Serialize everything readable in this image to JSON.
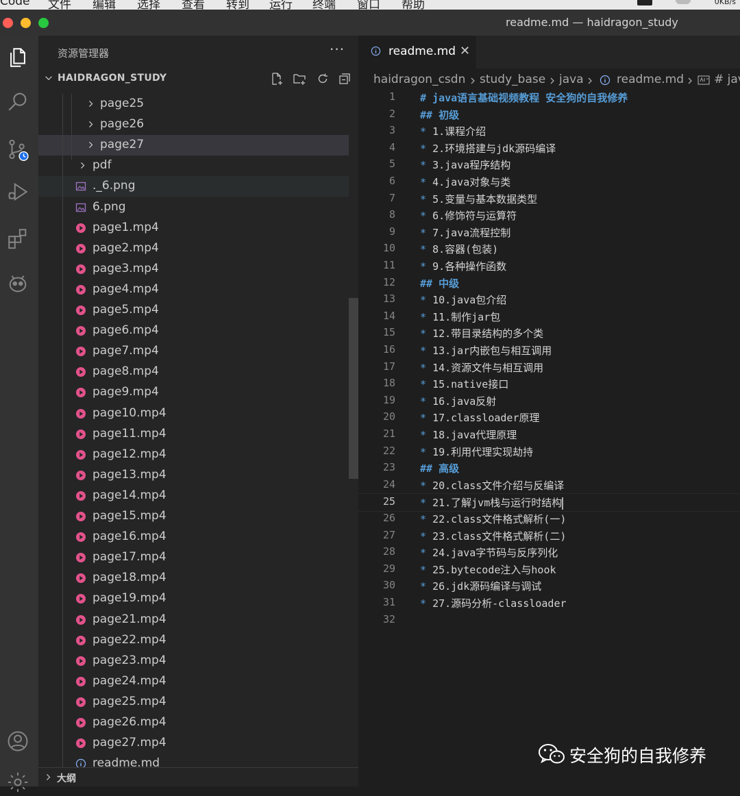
{
  "window": {
    "title": "readme.md — haidragon_study"
  },
  "menubar": {
    "items": [
      "Code",
      "文件",
      "编辑",
      "选择",
      "查看",
      "转到",
      "运行",
      "终端",
      "窗口",
      "帮助"
    ],
    "net_speed": "0KB/s"
  },
  "sidebar": {
    "title": "资源管理器",
    "more": "···",
    "folder": "HAIDRAGON_STUDY",
    "tree": [
      {
        "label": "page25",
        "type": "folder"
      },
      {
        "label": "page26",
        "type": "folder"
      },
      {
        "label": "page27",
        "type": "folder"
      },
      {
        "label": "pdf",
        "type": "folder"
      },
      {
        "label": "._6.png",
        "type": "image"
      },
      {
        "label": "6.png",
        "type": "image"
      },
      {
        "label": "page1.mp4",
        "type": "video"
      },
      {
        "label": "page2.mp4",
        "type": "video"
      },
      {
        "label": "page3.mp4",
        "type": "video"
      },
      {
        "label": "page4.mp4",
        "type": "video"
      },
      {
        "label": "page5.mp4",
        "type": "video"
      },
      {
        "label": "page6.mp4",
        "type": "video"
      },
      {
        "label": "page7.mp4",
        "type": "video"
      },
      {
        "label": "page8.mp4",
        "type": "video"
      },
      {
        "label": "page9.mp4",
        "type": "video"
      },
      {
        "label": "page10.mp4",
        "type": "video"
      },
      {
        "label": "page11.mp4",
        "type": "video"
      },
      {
        "label": "page12.mp4",
        "type": "video"
      },
      {
        "label": "page13.mp4",
        "type": "video"
      },
      {
        "label": "page14.mp4",
        "type": "video"
      },
      {
        "label": "page15.mp4",
        "type": "video"
      },
      {
        "label": "page16.mp4",
        "type": "video"
      },
      {
        "label": "page17.mp4",
        "type": "video"
      },
      {
        "label": "page18.mp4",
        "type": "video"
      },
      {
        "label": "page19.mp4",
        "type": "video"
      },
      {
        "label": "page21.mp4",
        "type": "video"
      },
      {
        "label": "page22.mp4",
        "type": "video"
      },
      {
        "label": "page23.mp4",
        "type": "video"
      },
      {
        "label": "page24.mp4",
        "type": "video"
      },
      {
        "label": "page25.mp4",
        "type": "video"
      },
      {
        "label": "page26.mp4",
        "type": "video"
      },
      {
        "label": "page27.mp4",
        "type": "video"
      },
      {
        "label": "readme.md",
        "type": "info"
      }
    ],
    "outline": "大纲"
  },
  "editor": {
    "tab": {
      "label": "readme.md",
      "close": "✕"
    },
    "breadcrumb": [
      "haidragon_csdn",
      "study_base",
      "java",
      "readme.md",
      "# java"
    ],
    "current_line": 25,
    "lines": [
      {
        "n": "1",
        "text": "# java语言基础视频教程 安全狗的自我修养",
        "kind": "h"
      },
      {
        "n": "2",
        "text": "## 初级",
        "kind": "h"
      },
      {
        "n": "3",
        "text": "1.课程介绍",
        "kind": "b"
      },
      {
        "n": "4",
        "text": "2.环境搭建与jdk源码编译",
        "kind": "b"
      },
      {
        "n": "5",
        "text": "3.java程序结构",
        "kind": "b"
      },
      {
        "n": "6",
        "text": "4.java对象与类",
        "kind": "b"
      },
      {
        "n": "7",
        "text": "5.变量与基本数据类型",
        "kind": "b"
      },
      {
        "n": "8",
        "text": "6.修饰符与运算符",
        "kind": "b"
      },
      {
        "n": "9",
        "text": "7.java流程控制",
        "kind": "b"
      },
      {
        "n": "10",
        "text": "8.容器(包装)",
        "kind": "b"
      },
      {
        "n": "11",
        "text": "9.各种操作函数",
        "kind": "b"
      },
      {
        "n": "12",
        "text": "## 中级",
        "kind": "h"
      },
      {
        "n": "13",
        "text": "10.java包介绍",
        "kind": "b"
      },
      {
        "n": "14",
        "text": "11.制作jar包",
        "kind": "b"
      },
      {
        "n": "15",
        "text": "12.带目录结构的多个类",
        "kind": "b"
      },
      {
        "n": "16",
        "text": "13.jar内嵌包与相互调用",
        "kind": "b"
      },
      {
        "n": "17",
        "text": "14.资源文件与相互调用",
        "kind": "b"
      },
      {
        "n": "18",
        "text": "15.native接口",
        "kind": "b"
      },
      {
        "n": "19",
        "text": "16.java反射",
        "kind": "b"
      },
      {
        "n": "20",
        "text": "17.classloader原理",
        "kind": "b"
      },
      {
        "n": "21",
        "text": "18.java代理原理",
        "kind": "b"
      },
      {
        "n": "22",
        "text": "19.利用代理实现劫持",
        "kind": "b"
      },
      {
        "n": "23",
        "text": "## 高级",
        "kind": "h"
      },
      {
        "n": "24",
        "text": "20.class文件介绍与反编译",
        "kind": "b"
      },
      {
        "n": "25",
        "text": "21.了解jvm栈与运行时结构",
        "kind": "b"
      },
      {
        "n": "26",
        "text": "22.class文件格式解析(一)",
        "kind": "b"
      },
      {
        "n": "27",
        "text": "23.class文件格式解析(二)",
        "kind": "b"
      },
      {
        "n": "28",
        "text": "24.java字节码与反序列化",
        "kind": "b"
      },
      {
        "n": "29",
        "text": "25.bytecode注入与hook",
        "kind": "b"
      },
      {
        "n": "30",
        "text": "26.jdk源码编译与调试",
        "kind": "b"
      },
      {
        "n": "31",
        "text": "27.源码分析-classloader",
        "kind": "b"
      },
      {
        "n": "32",
        "text": "",
        "kind": "empty"
      }
    ]
  },
  "watermark": {
    "text": "安全狗的自我修养",
    "icon": "wechat-icon"
  },
  "colors": {
    "accent": "#569cd6",
    "video_icon": "#e2528a",
    "info_icon": "#8ab4f8",
    "image_icon": "#a074c4"
  }
}
